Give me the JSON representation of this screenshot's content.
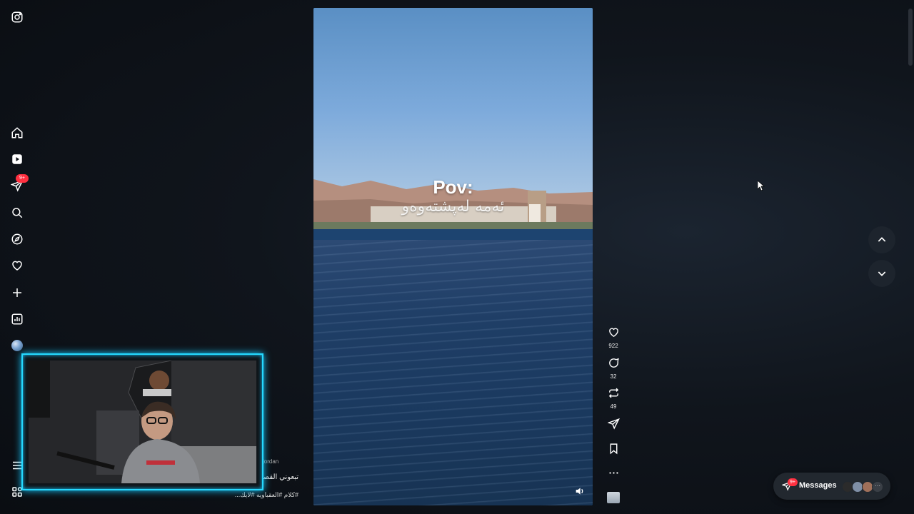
{
  "rail": {
    "items": [
      "instagram-logo",
      "home",
      "reels",
      "messages",
      "search",
      "explore",
      "notifications",
      "create",
      "dashboard",
      "profile",
      "more",
      "also-from-meta"
    ],
    "messages_badge": "9+"
  },
  "reel": {
    "title_overlay": "Pov:",
    "subtitle_overlay": "ئەمە لەپشتەوەو"
  },
  "actions": {
    "likes": "922",
    "comments": "32",
    "reposts": "49"
  },
  "caption": {
    "user": "jordan",
    "line1": "تبعوني القصة",
    "line2": "#كلام #العقباويه #لايك..."
  },
  "messages": {
    "badge": "9+",
    "label": "Messages"
  },
  "colors": {
    "accent_badge": "#ff3040",
    "webcam_border": "#25d9ff",
    "background": "#0c1016"
  }
}
